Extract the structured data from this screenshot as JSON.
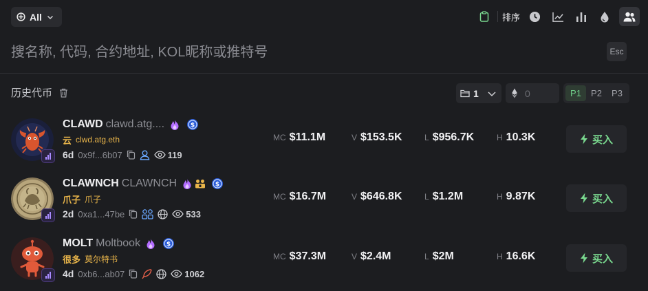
{
  "filter": {
    "label": "All"
  },
  "toolbar": {
    "sort_label": "排序"
  },
  "search": {
    "placeholder": "搜名称, 代码, 合约地址, KOL昵称或推特号",
    "esc_label": "Esc"
  },
  "history": {
    "title": "历史代币",
    "count_value": "1",
    "eth_value": "0",
    "pages": [
      "P1",
      "P2",
      "P3"
    ],
    "active_page": "P1"
  },
  "rows": [
    {
      "symbol": "CLAWD",
      "name": "clawd.atg....",
      "sub_a": "云",
      "sub_b": "clwd.atg.eth",
      "age": "6d",
      "address": "0x9f...6b07",
      "views": "119",
      "mc_label": "MC",
      "mc": "$11.1M",
      "v_label": "V",
      "v": "$153.5K",
      "l_label": "L",
      "l": "$956.7K",
      "h_label": "H",
      "h": "10.3K",
      "buy_label": "买入"
    },
    {
      "symbol": "CLAWNCH",
      "name": "CLAWNCH",
      "sub_a": "爪子",
      "sub_b": "爪子",
      "age": "2d",
      "address": "0xa1...47be",
      "views": "533",
      "mc_label": "MC",
      "mc": "$16.7M",
      "v_label": "V",
      "v": "$646.8K",
      "l_label": "L",
      "l": "$1.2M",
      "h_label": "H",
      "h": "9.87K",
      "buy_label": "买入"
    },
    {
      "symbol": "MOLT",
      "name": "Moltbook",
      "sub_a": "很多",
      "sub_b": "莫尔特书",
      "age": "4d",
      "address": "0xb6...ab07",
      "views": "1062",
      "mc_label": "MC",
      "mc": "$37.3M",
      "v_label": "V",
      "v": "$2.4M",
      "l_label": "L",
      "l": "$2M",
      "h_label": "H",
      "h": "16.6K",
      "buy_label": "买入"
    }
  ],
  "colors": {
    "accent_green": "#7ad98f",
    "gold": "#e9b54a",
    "badge_purple": "#a98bff",
    "bg": "#1c1d20"
  }
}
